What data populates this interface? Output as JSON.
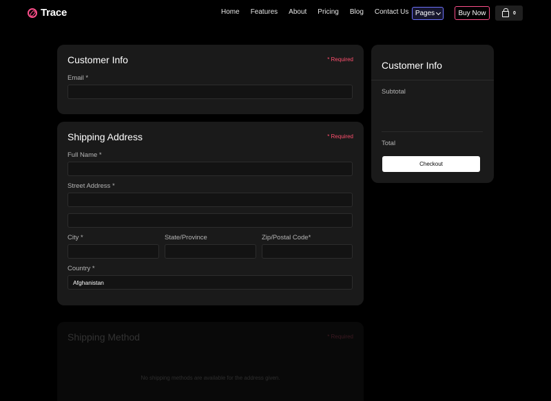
{
  "brand": {
    "name": "Trace",
    "icon": "compass-icon",
    "accent": "#ff4f8b"
  },
  "nav": {
    "links": [
      "Home",
      "Features",
      "About",
      "Pricing",
      "Blog",
      "Contact Us"
    ],
    "pages_label": "Pages",
    "buy_label": "Buy Now",
    "cart_count": "0"
  },
  "customer_info": {
    "title": "Customer Info",
    "required_note": "* Required",
    "email_label": "Email *",
    "email_value": ""
  },
  "shipping_address": {
    "title": "Shipping Address",
    "required_note": "* Required",
    "full_name_label": "Full Name *",
    "street_label": "Street Address *",
    "city_label": "City *",
    "state_label": "State/Province",
    "zip_label": "Zip/Postal Code*",
    "country_label": "Country *",
    "country_value": "Afghanistan"
  },
  "shipping_method": {
    "title": "Shipping Method",
    "required_note": "* Required",
    "empty_message": "No shipping methods are available for the address given."
  },
  "summary": {
    "title": "Customer Info",
    "subtotal_label": "Subtotal",
    "total_label": "Total",
    "checkout_label": "Checkout"
  }
}
